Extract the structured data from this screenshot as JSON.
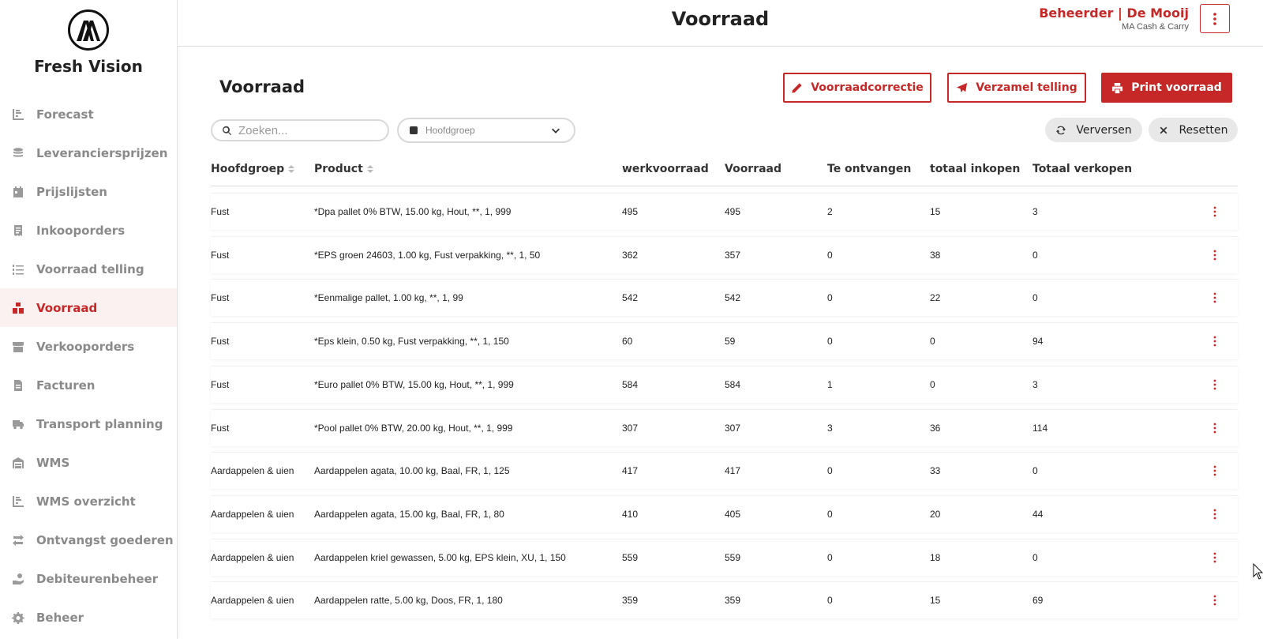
{
  "brand": {
    "name": "Fresh Vision"
  },
  "sidebar": {
    "items": [
      {
        "label": "Forecast",
        "icon": "chart-bar-icon",
        "active": false
      },
      {
        "label": "Leveranciersprijzen",
        "icon": "coins-icon",
        "active": false
      },
      {
        "label": "Prijslijsten",
        "icon": "calendar-icon",
        "active": false
      },
      {
        "label": "Inkooporders",
        "icon": "receipt-icon",
        "active": false
      },
      {
        "label": "Voorraad telling",
        "icon": "list-ordered-icon",
        "active": false
      },
      {
        "label": "Voorraad",
        "icon": "boxes-icon",
        "active": true
      },
      {
        "label": "Verkooporders",
        "icon": "store-icon",
        "active": false
      },
      {
        "label": "Facturen",
        "icon": "invoice-icon",
        "active": false
      },
      {
        "label": "Transport planning",
        "icon": "truck-icon",
        "active": false
      },
      {
        "label": "WMS",
        "icon": "warehouse-icon",
        "active": false
      },
      {
        "label": "WMS overzicht",
        "icon": "chart-bar-icon",
        "active": false
      },
      {
        "label": "Ontvangst goederen",
        "icon": "exchange-icon",
        "active": false
      },
      {
        "label": "Debiteurenbeheer",
        "icon": "hand-money-icon",
        "active": false
      },
      {
        "label": "Beheer",
        "icon": "gear-icon",
        "active": false
      }
    ]
  },
  "header": {
    "title": "Voorraad",
    "user_name": "Beheerder | De Mooij",
    "company": "MA Cash & Carry"
  },
  "main": {
    "title": "Voorraad",
    "buttons": {
      "correctie": "Voorraadcorrectie",
      "telling": "Verzamel telling",
      "print": "Print voorraad",
      "verversen": "Verversen",
      "resetten": "Resetten"
    },
    "search": {
      "placeholder": "Zoeken...",
      "value": ""
    },
    "filter": {
      "placeholder": "Hoofdgroep"
    }
  },
  "table": {
    "columns": [
      "Hoofdgroep",
      "Product",
      "werkvoorraad",
      "Voorraad",
      "Te ontvangen",
      "totaal inkopen",
      "Totaal verkopen"
    ],
    "rows": [
      {
        "hoofdgroep": "Fust",
        "product": "*Dpa pallet 0% BTW, 15.00 kg, Hout, **, 1, 999",
        "werkvoorraad": "495",
        "voorraad": "495",
        "te_ontvangen": "2",
        "totaal_inkopen": "15",
        "totaal_verkopen": "3"
      },
      {
        "hoofdgroep": "Fust",
        "product": "*EPS groen 24603, 1.00 kg, Fust verpakking, **, 1, 50",
        "werkvoorraad": "362",
        "voorraad": "357",
        "te_ontvangen": "0",
        "totaal_inkopen": "38",
        "totaal_verkopen": "0"
      },
      {
        "hoofdgroep": "Fust",
        "product": "*Eenmalige pallet, 1.00 kg, **, 1, 99",
        "werkvoorraad": "542",
        "voorraad": "542",
        "te_ontvangen": "0",
        "totaal_inkopen": "22",
        "totaal_verkopen": "0"
      },
      {
        "hoofdgroep": "Fust",
        "product": "*Eps klein, 0.50 kg, Fust verpakking, **, 1, 150",
        "werkvoorraad": "60",
        "voorraad": "59",
        "te_ontvangen": "0",
        "totaal_inkopen": "0",
        "totaal_verkopen": "94"
      },
      {
        "hoofdgroep": "Fust",
        "product": "*Euro pallet 0% BTW, 15.00 kg, Hout, **, 1, 999",
        "werkvoorraad": "584",
        "voorraad": "584",
        "te_ontvangen": "1",
        "totaal_inkopen": "0",
        "totaal_verkopen": "3"
      },
      {
        "hoofdgroep": "Fust",
        "product": "*Pool pallet 0% BTW, 20.00 kg, Hout, **, 1, 999",
        "werkvoorraad": "307",
        "voorraad": "307",
        "te_ontvangen": "3",
        "totaal_inkopen": "36",
        "totaal_verkopen": "114"
      },
      {
        "hoofdgroep": "Aardappelen & uien",
        "product": "Aardappelen agata, 10.00 kg, Baal, FR, 1, 125",
        "werkvoorraad": "417",
        "voorraad": "417",
        "te_ontvangen": "0",
        "totaal_inkopen": "33",
        "totaal_verkopen": "0"
      },
      {
        "hoofdgroep": "Aardappelen & uien",
        "product": "Aardappelen agata, 15.00 kg, Baal, FR, 1, 80",
        "werkvoorraad": "410",
        "voorraad": "405",
        "te_ontvangen": "0",
        "totaal_inkopen": "20",
        "totaal_verkopen": "44"
      },
      {
        "hoofdgroep": "Aardappelen & uien",
        "product": "Aardappelen kriel gewassen, 5.00 kg, EPS klein, XU, 1, 150",
        "werkvoorraad": "559",
        "voorraad": "559",
        "te_ontvangen": "0",
        "totaal_inkopen": "18",
        "totaal_verkopen": "0"
      },
      {
        "hoofdgroep": "Aardappelen & uien",
        "product": "Aardappelen ratte, 5.00 kg, Doos, FR, 1, 180",
        "werkvoorraad": "359",
        "voorraad": "359",
        "te_ontvangen": "0",
        "totaal_inkopen": "15",
        "totaal_verkopen": "69"
      }
    ]
  },
  "colors": {
    "accent": "#c62828",
    "active_bg": "#fbf1f1",
    "muted": "#8a8a8a"
  }
}
